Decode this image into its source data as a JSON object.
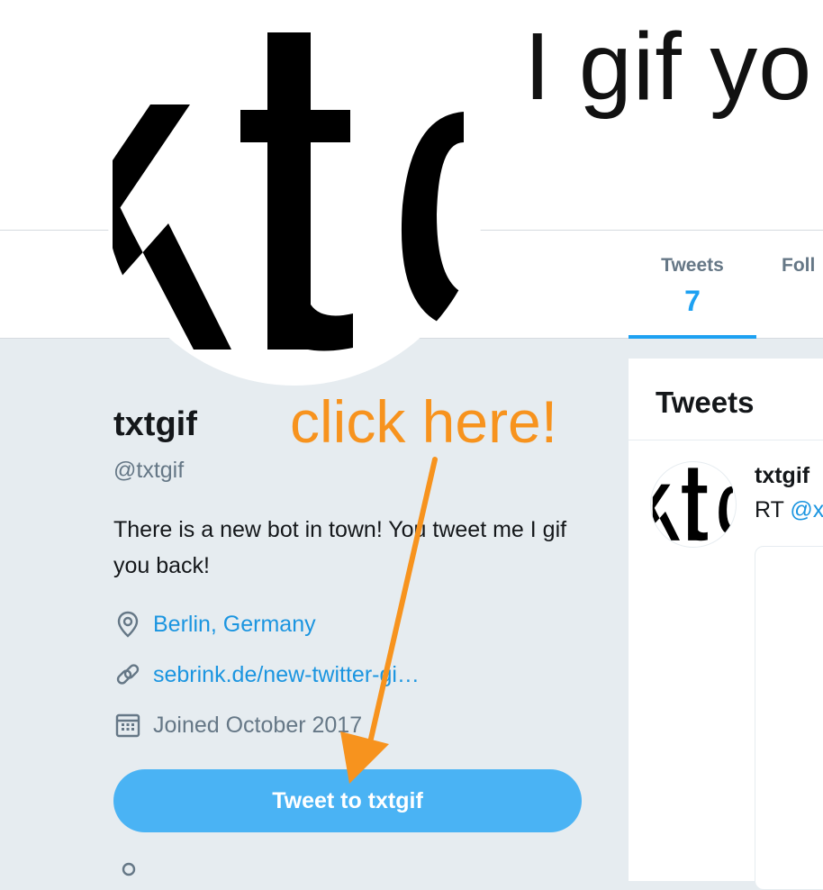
{
  "colors": {
    "accent": "#1da1f2",
    "link": "#1b95e0",
    "button": "#4ab3f4",
    "annotation": "#f7931e",
    "background": "#e6ecf0"
  },
  "header": {
    "banner_text": "I gif yo"
  },
  "avatar": {
    "logo_text": "xtgif",
    "icon": "txtgif-logo-icon"
  },
  "nav": {
    "tabs": [
      {
        "label": "Tweets",
        "count": "7",
        "active": true
      },
      {
        "label": "Foll",
        "count": ""
      }
    ]
  },
  "profile": {
    "name": "txtgif",
    "handle": "@txtgif",
    "bio": "There is a new bot in town! You tweet me I gif you back!",
    "location": "Berlin, Germany",
    "location_icon": "location-pin-icon",
    "website": "sebrink.de/new-twitter-gi…",
    "website_icon": "link-icon",
    "joined": "Joined October 2017",
    "joined_icon": "calendar-icon"
  },
  "actions": {
    "tweet_to_label": "Tweet to txtgif"
  },
  "tweets_panel": {
    "title": "Tweets",
    "tweet": {
      "author": "txtgif",
      "text_prefix": "RT ",
      "mention": "@x"
    }
  },
  "annotation": {
    "text": "click here!"
  }
}
